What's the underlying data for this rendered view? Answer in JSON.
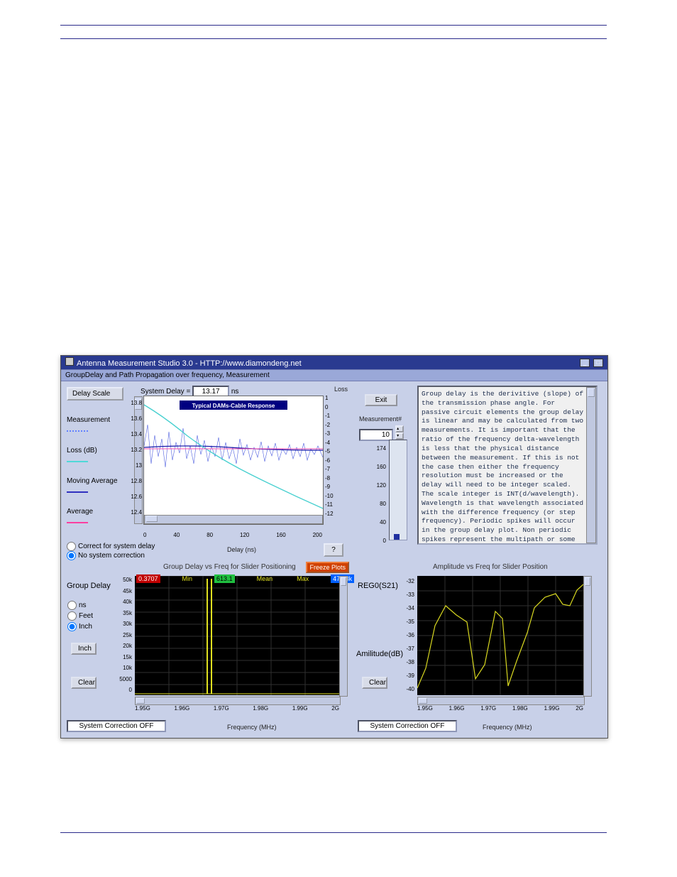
{
  "window": {
    "title": "Antenna Measurement Studio 3.0 - HTTP://www.diamondeng.net",
    "subtitle": "GroupDelay and Path Propagation over frequency, Measurement"
  },
  "topleft": {
    "delay_scale_label": "Delay Scale",
    "system_delay_label": "System Delay =",
    "system_delay_value": "13.17",
    "system_delay_unit": "ns",
    "loss_label": "Loss",
    "measurement_label": "Measurement",
    "loss_db_label": "Loss (dB)",
    "moving_avg_label": "Moving Average",
    "average_label": "Average",
    "chart_caption": "Typical DAMs-Cable Response",
    "xaxis": "Delay (ns)",
    "xticks": [
      "0",
      "40",
      "80",
      "120",
      "160",
      "200"
    ],
    "yticks_left": [
      "13.8",
      "13.6",
      "13.4",
      "13.2",
      "13",
      "12.8",
      "12.6",
      "12.4"
    ],
    "yticks_right": [
      "1",
      "0",
      "-1",
      "-2",
      "-3",
      "-4",
      "-5",
      "-6",
      "-7",
      "-8",
      "-9",
      "-10",
      "-11",
      "-12"
    ],
    "help": "?",
    "radios": {
      "opt1": "Correct for system delay",
      "opt2": "No system correction"
    }
  },
  "middle": {
    "exit": "Exit",
    "measurement_num_label": "Measurement#",
    "measurement_num_value": "10",
    "thermo_ticks": [
      "174",
      "160",
      "120",
      "80",
      "40",
      "0"
    ]
  },
  "info": {
    "text": "Group delay is the derivitive (slope) of the transmission phase angle. For passive circuit elements the group delay is linear and may be calculated from two measurements. It is important that the ratio of the frequency delta-wavelength is less that the physical distance between the measurement. If this is not the case then either the frequency resolution must be increased or the delay will need to be integer scaled. The scale integer is INT(d/wavelength). Wavelength is that wavelength associated with the difference frequency (or step frequency). Periodic spikes will occur in the group delay plot. Non periodic spikes represent the multipath or some other source of distortion. ******IMPORTANT >> If you had checked \"correction\" or \"NO correction \""
  },
  "botleft": {
    "title_above": "Group Delay vs Freq for Slider Positioning",
    "freeze": "Freeze Plots",
    "group_delay_label": "Group Delay",
    "min_label": "Min",
    "min_val": "0.3707",
    "mean_label": "Mean",
    "mean_val": "613.1",
    "max_label": "Max",
    "max_val": "47.08k",
    "units": {
      "ns": "ns",
      "feet": "Feet",
      "inch": "Inch"
    },
    "inch_btn": "Inch",
    "clear": "Clear",
    "status": "System Correction OFF",
    "xaxis": "Frequency (MHz)",
    "yticks": [
      "50k",
      "45k",
      "40k",
      "35k",
      "30k",
      "25k",
      "20k",
      "15k",
      "10k",
      "5000",
      "0"
    ],
    "xticks": [
      "1.95G",
      "1.96G",
      "1.97G",
      "1.98G",
      "1.99G",
      "2G"
    ]
  },
  "botright": {
    "title_above": "Amplitude vs Freq for Slider Position",
    "reg_label": "REG0(S21)",
    "amp_label": "Amilitude(dB)",
    "clear": "Clear",
    "status": "System Correction OFF",
    "xaxis": "Frequency (MHz)",
    "yticks": [
      "-32",
      "-33",
      "-34",
      "-35",
      "-36",
      "-37",
      "-38",
      "-39",
      "-40"
    ],
    "xticks": [
      "1.95G",
      "1.96G",
      "1.97G",
      "1.98G",
      "1.99G",
      "2G"
    ]
  },
  "chart_data": [
    {
      "type": "line",
      "title": "Typical DAMs-Cable Response",
      "x_range": [
        0,
        200
      ],
      "xlabel": "Delay (ns)",
      "series": [
        {
          "name": "Delay Scale",
          "axis": "left",
          "approx_mean": 13.17,
          "range": [
            12.4,
            13.8
          ],
          "note": "noisy ~13 ns moving average"
        },
        {
          "name": "Loss (dB)",
          "axis": "right",
          "range": [
            1,
            -12
          ],
          "note": "decaying loss curve"
        }
      ],
      "left_axis": {
        "range": [
          12.4,
          13.8
        ],
        "label": "ns"
      },
      "right_axis": {
        "range": [
          -12,
          1
        ],
        "label": "Loss dB"
      }
    },
    {
      "type": "line",
      "title": "Group Delay vs Freq for Slider Positioning",
      "xlabel": "Frequency (MHz)",
      "ylabel": "Group Delay",
      "xlim": [
        "1.95G",
        "2G"
      ],
      "ylim": [
        0,
        50000
      ],
      "stats": {
        "min": 0.3707,
        "mean": 613.1,
        "max": 47080
      },
      "note": "two tall spikes near ~1.968G, baseline ~0"
    },
    {
      "type": "line",
      "title": "Amplitude vs Freq for Slider Position",
      "xlabel": "Frequency (MHz)",
      "ylabel": "Amplitude (dB)",
      "xlim": [
        "1.95G",
        "2G"
      ],
      "ylim": [
        -40,
        -32
      ],
      "x": [
        1.95,
        1.955,
        1.96,
        1.963,
        1.967,
        1.97,
        1.975,
        1.978,
        1.982,
        1.986,
        1.99,
        1.995,
        2.0
      ],
      "y": [
        -39.5,
        -38,
        -34,
        -35,
        -39,
        -38,
        -34.5,
        -39.5,
        -37,
        -34,
        -33,
        -34,
        -32.5
      ]
    }
  ]
}
